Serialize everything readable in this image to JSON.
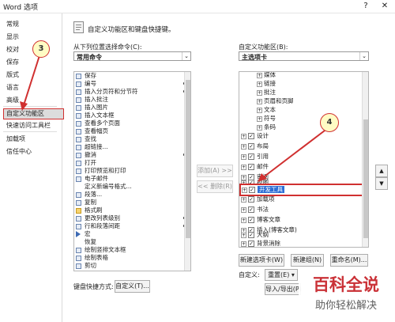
{
  "window": {
    "title": "Word 选项",
    "help": "?",
    "close": "✕"
  },
  "nav": {
    "items": [
      {
        "label": "常规"
      },
      {
        "label": "显示"
      },
      {
        "label": "校对"
      },
      {
        "label": "保存"
      },
      {
        "label": "版式"
      },
      {
        "label": "语言"
      },
      {
        "label": "高级"
      },
      {
        "label": "自定义功能区"
      },
      {
        "label": "快速访问工具栏"
      },
      {
        "label": "加载项"
      },
      {
        "label": "信任中心"
      }
    ]
  },
  "header": {
    "title": "自定义功能区和键盘快捷键。"
  },
  "left": {
    "choose_label": "从下列位置选择命令(C):",
    "choose_value": "常用命令",
    "commands": [
      {
        "label": "保存"
      },
      {
        "label": "编号",
        "sub": "▸"
      },
      {
        "label": "插入分页符和分节符",
        "sub": "▸"
      },
      {
        "label": "插入批注"
      },
      {
        "label": "插入图片"
      },
      {
        "label": "插入文本框"
      },
      {
        "label": "查看多个页面"
      },
      {
        "label": "查看幅页"
      },
      {
        "label": "查找"
      },
      {
        "label": "超链接..."
      },
      {
        "label": "撤消",
        "sub": "▸"
      },
      {
        "label": "打开"
      },
      {
        "label": "打印预览和打印"
      },
      {
        "label": "电子邮件"
      },
      {
        "label": "定义新编号格式..."
      },
      {
        "label": "段落..."
      },
      {
        "label": "复制"
      },
      {
        "label": "格式刷"
      },
      {
        "label": "更改列表级别",
        "sub": "▸"
      },
      {
        "label": "行和段落间距",
        "sub": "▸"
      },
      {
        "label": "宏"
      },
      {
        "label": "恢复"
      },
      {
        "label": "绘制竖排文本框"
      },
      {
        "label": "绘制表格"
      },
      {
        "label": "剪切"
      }
    ],
    "kbd_label": "键盘快捷方式:",
    "kbd_button": "自定义(T)..."
  },
  "middle": {
    "add": "添加(A) >>",
    "remove": "<< 删除(R)"
  },
  "right": {
    "custom_label": "自定义功能区(B):",
    "custom_value": "主选项卡",
    "subitems": [
      {
        "label": "媒体"
      },
      {
        "label": "链接"
      },
      {
        "label": "批注"
      },
      {
        "label": "页眉和页脚"
      },
      {
        "label": "文本"
      },
      {
        "label": "符号"
      },
      {
        "label": "条码"
      }
    ],
    "tabs": [
      {
        "label": "设计"
      },
      {
        "label": "布局"
      },
      {
        "label": "引用"
      },
      {
        "label": "邮件"
      },
      {
        "label": "审阅"
      },
      {
        "label": "视图"
      },
      {
        "label": "开发工具",
        "selected": true
      },
      {
        "label": "加载项"
      },
      {
        "label": "书法"
      },
      {
        "label": "博客文章"
      },
      {
        "label": "插入(博客文章)"
      },
      {
        "label": "大纲"
      },
      {
        "label": "背景消除"
      }
    ],
    "new_tab": "新建选项卡(W)",
    "new_group": "新建组(N)",
    "rename": "重命名(M)...",
    "customize_label": "自定义:",
    "reset": "重置(E)",
    "import_export": "导入/导出(P)"
  },
  "callouts": {
    "c3": "3",
    "c4": "4"
  },
  "watermark": {
    "big": "百科全说",
    "small": "助你轻松解决"
  },
  "colors": {
    "accent": "#d03030",
    "watermark_red": "#c7252b",
    "callout_fill": "#fffcc4",
    "selection": "#2e6fd6"
  }
}
